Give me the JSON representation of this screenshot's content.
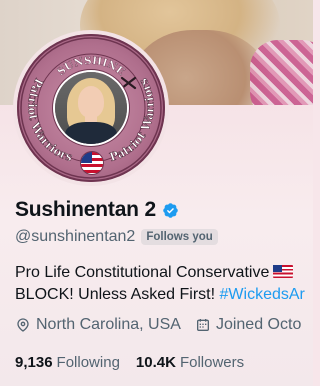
{
  "profile": {
    "display_name": "Sushinentan 2",
    "handle": "@sunshinentan2",
    "follows_you": "Follows you",
    "verified_icon": "verified-badge-icon",
    "avatar": {
      "top_text": "SUNSHINE",
      "left_text": "Patriot Warriors",
      "right_text": "Patriot Warriors"
    },
    "bio_line1": "Pro Life Constitutional Conservative",
    "bio_line2": "BLOCK! Unless Asked First!",
    "bio_hashtag": "#WickedsAr",
    "location": "North Carolina, USA",
    "joined": "Joined Octo",
    "following_count": "9,136",
    "following_label": "Following",
    "followers_count": "10.4K",
    "followers_label": "Followers"
  },
  "colors": {
    "verified": "#1d9bf0",
    "hashtag": "#1d9bf0",
    "muted": "#536471",
    "avatar_ring": "#b06f8d"
  }
}
